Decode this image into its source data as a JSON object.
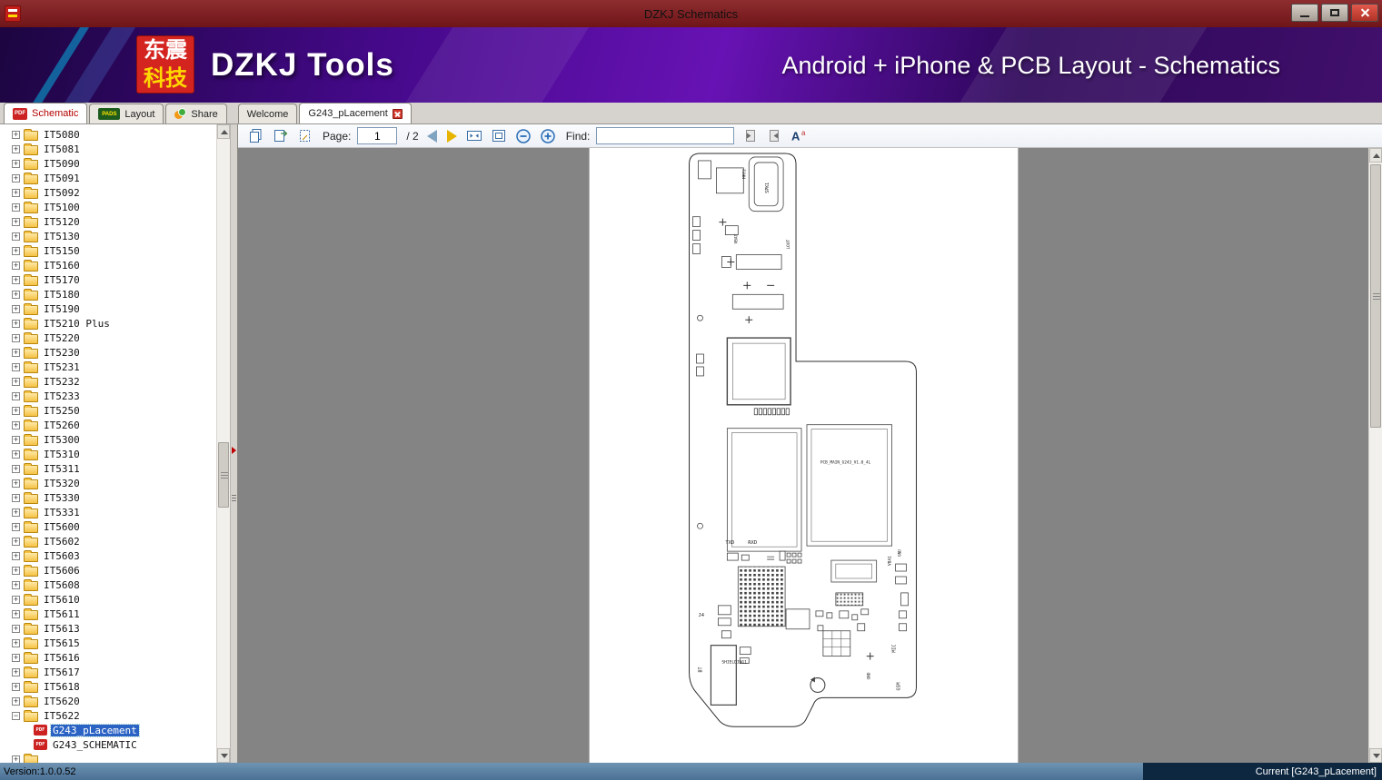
{
  "window": {
    "title": "DZKJ Schematics"
  },
  "banner": {
    "logo_top": "东震",
    "logo_bottom": "科技",
    "app_name": "DZKJ Tools",
    "tagline": "Android + iPhone & PCB Layout - Schematics"
  },
  "ribbon_tabs": [
    {
      "label": "Schematic",
      "badge": "PDF"
    },
    {
      "label": "Layout",
      "badge": "PADS"
    },
    {
      "label": "Share",
      "badge": ""
    }
  ],
  "doc_tabs": [
    {
      "label": "Welcome"
    },
    {
      "label": "G243_pLacement"
    }
  ],
  "toolbar": {
    "page_label": "Page:",
    "page_value": "1",
    "page_total": "/ 2",
    "find_label": "Find:",
    "find_value": "",
    "font_icon_main": "A",
    "font_icon_sup": "a"
  },
  "tree": {
    "pdf_badge": "PDF",
    "folders": [
      {
        "label": "IT5080"
      },
      {
        "label": "IT5081"
      },
      {
        "label": "IT5090"
      },
      {
        "label": "IT5091"
      },
      {
        "label": "IT5092"
      },
      {
        "label": "IT5100"
      },
      {
        "label": "IT5120"
      },
      {
        "label": "IT5130"
      },
      {
        "label": "IT5150"
      },
      {
        "label": "IT5160"
      },
      {
        "label": "IT5170"
      },
      {
        "label": "IT5180"
      },
      {
        "label": "IT5190"
      },
      {
        "label": "IT5210 Plus"
      },
      {
        "label": "IT5220"
      },
      {
        "label": "IT5230"
      },
      {
        "label": "IT5231"
      },
      {
        "label": "IT5232"
      },
      {
        "label": "IT5233"
      },
      {
        "label": "IT5250"
      },
      {
        "label": "IT5260"
      },
      {
        "label": "IT5300"
      },
      {
        "label": "IT5310"
      },
      {
        "label": "IT5311"
      },
      {
        "label": "IT5320"
      },
      {
        "label": "IT5330"
      },
      {
        "label": "IT5331"
      },
      {
        "label": "IT5600"
      },
      {
        "label": "IT5602"
      },
      {
        "label": "IT5603"
      },
      {
        "label": "IT5606"
      },
      {
        "label": "IT5608"
      },
      {
        "label": "IT5610"
      },
      {
        "label": "IT5611"
      },
      {
        "label": "IT5613"
      },
      {
        "label": "IT5615"
      },
      {
        "label": "IT5616"
      },
      {
        "label": "IT5617"
      },
      {
        "label": "IT5618"
      },
      {
        "label": "IT5620"
      },
      {
        "label": "IT5622",
        "expanded": true,
        "children": [
          {
            "label": "G243_pLacement",
            "selected": true
          },
          {
            "label": "G243_SCHEMATIC"
          }
        ]
      },
      {
        "label": ""
      }
    ]
  },
  "pcb": {
    "board_name": "PCB_MAIN_G243_V1.0_4L",
    "labels": {
      "mrt2": "MRT2",
      "spk1": "SPK1",
      "vbat": "VBAT",
      "lout": "LOUT",
      "txd": "TXD",
      "rxd": "RXD",
      "vba1": "VBA1",
      "gnd1": "GND",
      "gnd2": "GND",
      "j4": "J4",
      "mic": "MIC",
      "bt": "BT",
      "shielding": "SHIELDING1",
      "gsm": "GSM"
    }
  },
  "statusbar": {
    "version": "Version:1.0.0.52",
    "current": "Current [G243_pLacement]"
  }
}
